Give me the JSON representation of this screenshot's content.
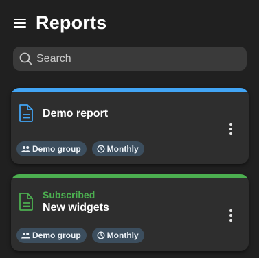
{
  "header": {
    "title": "Reports",
    "menu_icon": "hamburger-menu-icon"
  },
  "search": {
    "placeholder": "Search",
    "value": "",
    "icon": "search-icon"
  },
  "colors": {
    "background": "#202020",
    "card": "#2e2e2e",
    "accent_blue": "#42a5f5",
    "accent_green": "#4caf50",
    "chip": "#3c4e5e"
  },
  "reports": [
    {
      "title": "Demo report",
      "status": "",
      "icon": "document-icon",
      "accent": "blue",
      "group_chip": "Demo group",
      "schedule_chip": "Monthly"
    },
    {
      "title": "New widgets",
      "status": "Subscribed",
      "icon": "document-icon",
      "accent": "green",
      "group_chip": "Demo group",
      "schedule_chip": "Monthly"
    }
  ]
}
